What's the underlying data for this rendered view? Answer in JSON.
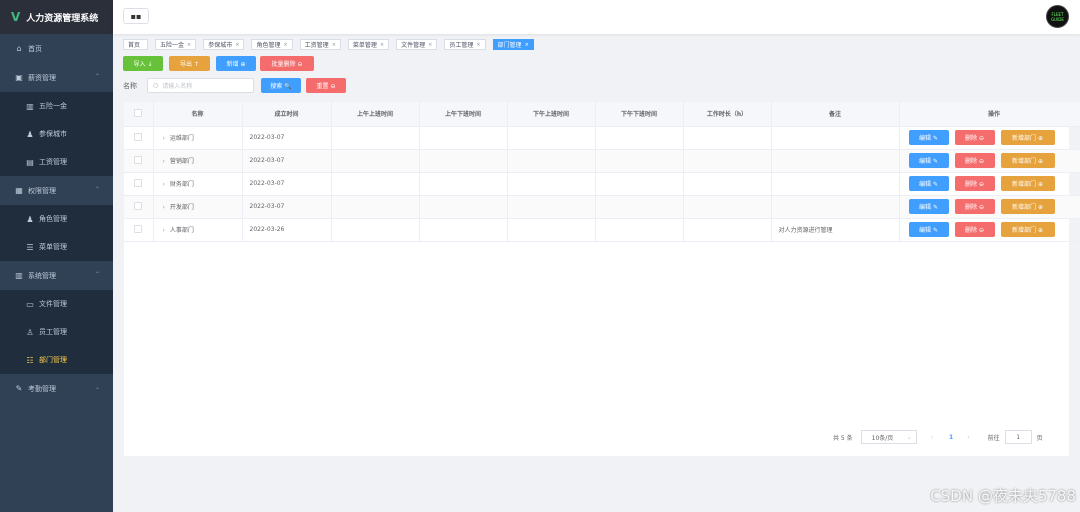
{
  "app": {
    "title": "人力资源管理系统",
    "logo_glyph": "V"
  },
  "sidebar": {
    "items": [
      {
        "label": "首页",
        "icon": "⌂",
        "arrow": ""
      },
      {
        "label": "薪资管理",
        "icon": "▣",
        "arrow": "⌃"
      },
      {
        "label": "五险一金",
        "icon": "▥",
        "arrow": ""
      },
      {
        "label": "参保城市",
        "icon": "♟",
        "arrow": ""
      },
      {
        "label": "工资管理",
        "icon": "▤",
        "arrow": ""
      },
      {
        "label": "权限管理",
        "icon": "▦",
        "arrow": "⌃"
      },
      {
        "label": "角色管理",
        "icon": "♟",
        "arrow": ""
      },
      {
        "label": "菜单管理",
        "icon": "☰",
        "arrow": ""
      },
      {
        "label": "系统管理",
        "icon": "▥",
        "arrow": "⌃"
      },
      {
        "label": "文件管理",
        "icon": "▭",
        "arrow": ""
      },
      {
        "label": "员工管理",
        "icon": "♙",
        "arrow": ""
      },
      {
        "label": "部门管理",
        "icon": "☷",
        "arrow": ""
      },
      {
        "label": "考勤管理",
        "icon": "✎",
        "arrow": "⌄"
      }
    ]
  },
  "header": {
    "toggle_icon": "▪▪",
    "avatar_text": "FLEET\nGUIDE"
  },
  "tags": [
    {
      "label": "首页",
      "close": ""
    },
    {
      "label": "五险一金",
      "close": "×"
    },
    {
      "label": "参保城市",
      "close": "×"
    },
    {
      "label": "角色管理",
      "close": "×"
    },
    {
      "label": "工资管理",
      "close": "×"
    },
    {
      "label": "菜单管理",
      "close": "×"
    },
    {
      "label": "文件管理",
      "close": "×"
    },
    {
      "label": "员工管理",
      "close": "×"
    },
    {
      "label": "部门管理",
      "close": "×"
    }
  ],
  "toolbar": {
    "import": "导入 ↓",
    "export": "导出 ↑",
    "add": "新增 ⊕",
    "batch_delete": "批量删除 ⊖"
  },
  "search": {
    "label": "名称",
    "placeholder": "请输入名称",
    "search_btn": "搜索 🔍",
    "reset_btn": "重置 ⊖",
    "icon": "○"
  },
  "table": {
    "headers": [
      "名称",
      "成立时间",
      "上午上班时间",
      "上午下班时间",
      "下午上班时间",
      "下午下班时间",
      "工作时长（h）",
      "备注",
      "操作"
    ],
    "rows": [
      {
        "name": "运维部门",
        "date": "2022-03-07",
        "am_in": "",
        "am_out": "",
        "pm_in": "",
        "pm_out": "",
        "hours": "",
        "note": ""
      },
      {
        "name": "营销部门",
        "date": "2022-03-07",
        "am_in": "",
        "am_out": "",
        "pm_in": "",
        "pm_out": "",
        "hours": "",
        "note": ""
      },
      {
        "name": "财务部门",
        "date": "2022-03-07",
        "am_in": "",
        "am_out": "",
        "pm_in": "",
        "pm_out": "",
        "hours": "",
        "note": ""
      },
      {
        "name": "开发部门",
        "date": "2022-03-07",
        "am_in": "",
        "am_out": "",
        "pm_in": "",
        "pm_out": "",
        "hours": "",
        "note": ""
      },
      {
        "name": "人事部门",
        "date": "2022-03-26",
        "am_in": "",
        "am_out": "",
        "pm_in": "",
        "pm_out": "",
        "hours": "",
        "note": "对人力资源进行管理"
      }
    ],
    "edit": "编辑 ✎",
    "delete": "删除 ⊖",
    "add_dept": "新增部门 ⊕",
    "chevron": "›"
  },
  "pager": {
    "total": "共 5 条",
    "size": "10条/页",
    "size_arrow": "⌄",
    "prev": "‹",
    "page": "1",
    "next": "›",
    "goto": "前往",
    "page_input": "1",
    "page_suffix": "页"
  },
  "watermark": "CSDN @夜未央5788"
}
